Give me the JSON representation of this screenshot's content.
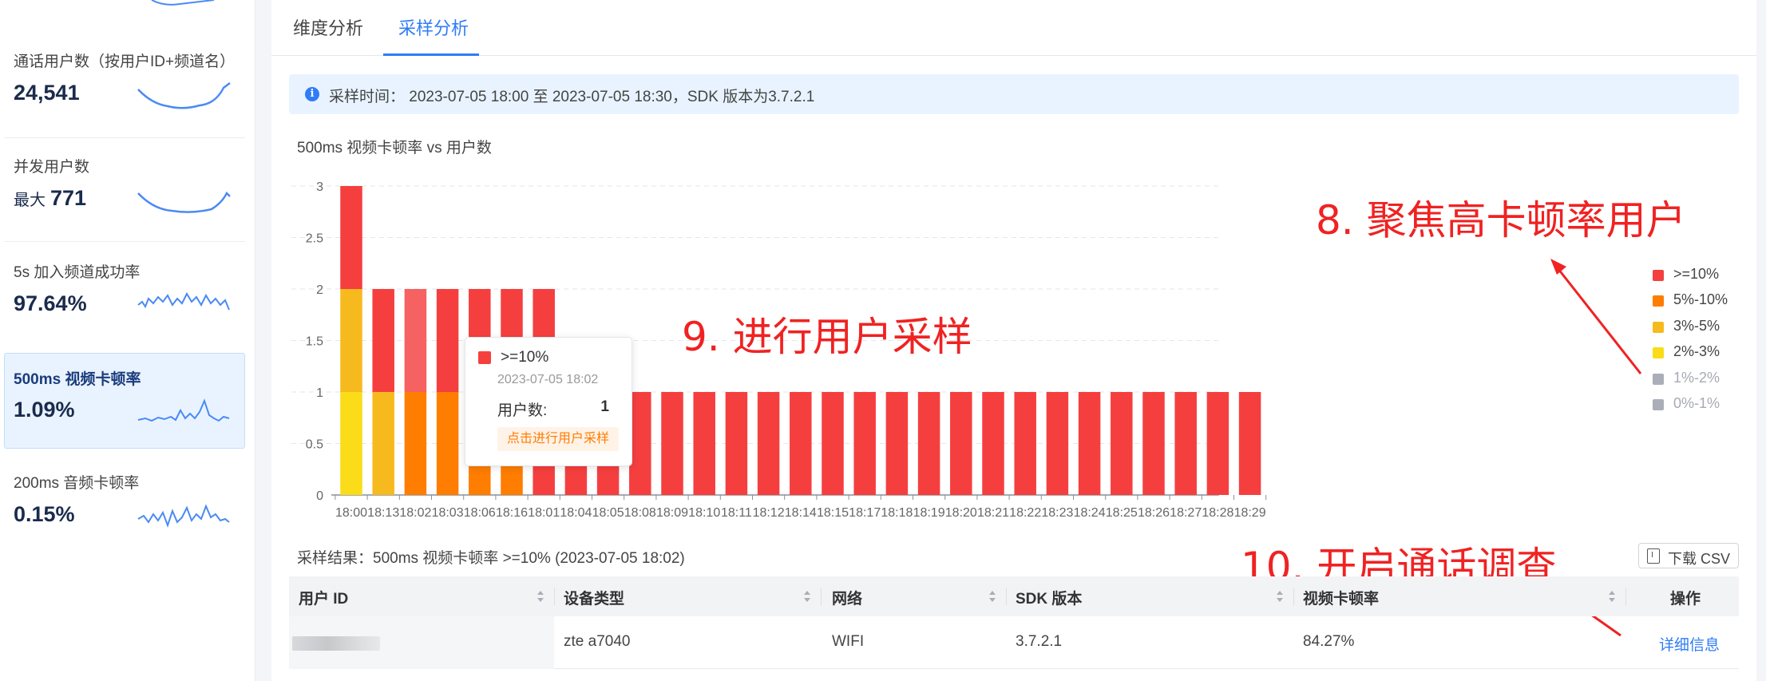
{
  "sidebar": {
    "metrics": [
      {
        "title": "通话用户数（按用户ID+频道名）",
        "prefix": "",
        "value": "24,541",
        "selected": false
      },
      {
        "title": "并发用户数",
        "prefix": "最大",
        "value": "771",
        "selected": false
      },
      {
        "title": "5s 加入频道成功率",
        "prefix": "",
        "value": "97.64%",
        "selected": false
      },
      {
        "title": "500ms 视频卡顿率",
        "prefix": "",
        "value": "1.09%",
        "selected": true
      },
      {
        "title": "200ms 音频卡顿率",
        "prefix": "",
        "value": "0.15%",
        "selected": false
      }
    ]
  },
  "tabs": [
    {
      "label": "维度分析",
      "active": false
    },
    {
      "label": "采样分析",
      "active": true
    }
  ],
  "info": {
    "icon": "info-icon",
    "text": "采样时间： 2023-07-05 18:00 至 2023-07-05 18:30，SDK 版本为3.7.2.1"
  },
  "chart_title": "500ms 视频卡顿率 vs 用户数",
  "chart_data": {
    "type": "bar",
    "stacked": true,
    "categories": [
      "18:00",
      "18:13",
      "18:02",
      "18:03",
      "18:06",
      "18:16",
      "18:01",
      "18:04",
      "18:05",
      "18:08",
      "18:09",
      "18:10",
      "18:11",
      "18:12",
      "18:14",
      "18:15",
      "18:17",
      "18:18",
      "18:19",
      "18:20",
      "18:21",
      "18:22",
      "18:23",
      "18:24",
      "18:25",
      "18:26",
      "18:27",
      "18:28",
      "18:29"
    ],
    "series": [
      {
        "name": "2%-3%",
        "color": "#fadc19",
        "values": [
          1,
          0,
          0,
          0,
          0,
          0,
          0,
          0,
          0,
          0,
          0,
          0,
          0,
          0,
          0,
          0,
          0,
          0,
          0,
          0,
          0,
          0,
          0,
          0,
          0,
          0,
          0,
          0,
          0
        ]
      },
      {
        "name": "3%-5%",
        "color": "#f7ba1e",
        "values": [
          1,
          1,
          0,
          0,
          0,
          0,
          0,
          0,
          0,
          0,
          0,
          0,
          0,
          0,
          0,
          0,
          0,
          0,
          0,
          0,
          0,
          0,
          0,
          0,
          0,
          0,
          0,
          0,
          0
        ]
      },
      {
        "name": "5%-10%",
        "color": "#ff7d00",
        "values": [
          0,
          0,
          1,
          1,
          1,
          1,
          0,
          0,
          0,
          0,
          0,
          0,
          0,
          0,
          0,
          0,
          0,
          0,
          0,
          0,
          0,
          0,
          0,
          0,
          0,
          0,
          0,
          0,
          0
        ]
      },
      {
        "name": ">=10%",
        "color": "#f53f3f",
        "values": [
          1,
          1,
          1,
          1,
          1,
          1,
          2,
          1,
          1,
          1,
          1,
          1,
          1,
          1,
          1,
          1,
          1,
          1,
          1,
          1,
          1,
          1,
          1,
          1,
          1,
          1,
          1,
          1,
          1
        ]
      }
    ],
    "yticks": [
      "0",
      "0.5",
      "1",
      "1.5",
      "2",
      "2.5",
      "3"
    ],
    "ylim": [
      0,
      3
    ],
    "grid": true,
    "legend_position": "right",
    "legend": [
      {
        "label": ">=10%",
        "color": "#f53f3f",
        "active": true
      },
      {
        "label": "5%-10%",
        "color": "#ff7d00",
        "active": true
      },
      {
        "label": "3%-5%",
        "color": "#f7ba1e",
        "active": true
      },
      {
        "label": "2%-3%",
        "color": "#fadc19",
        "active": true
      },
      {
        "label": "1%-2%",
        "color": "#a9aeb8",
        "active": false
      },
      {
        "label": "0%-1%",
        "color": "#a9aeb8",
        "active": false
      }
    ]
  },
  "tooltip": {
    "series": ">=10%",
    "time": "2023-07-05 18:02",
    "users_label": "用户数:",
    "users_value": "1",
    "action": "点击进行用户采样"
  },
  "annotations": {
    "a8": "8. 聚焦高卡顿率用户",
    "a9": "9. 进行用户采样",
    "a10": "10. 开启通话调查"
  },
  "sample": {
    "title": "采样结果：500ms 视频卡顿率 >=10% (2023-07-05 18:02)",
    "csv_label": "下载 CSV",
    "columns": [
      "用户 ID",
      "设备类型",
      "网络",
      "SDK 版本",
      "视频卡顿率",
      "操作"
    ],
    "rows": [
      {
        "device": "zte a7040",
        "network": "WIFI",
        "sdk": "3.7.2.1",
        "rate": "84.27%",
        "action": "详细信息"
      }
    ]
  }
}
